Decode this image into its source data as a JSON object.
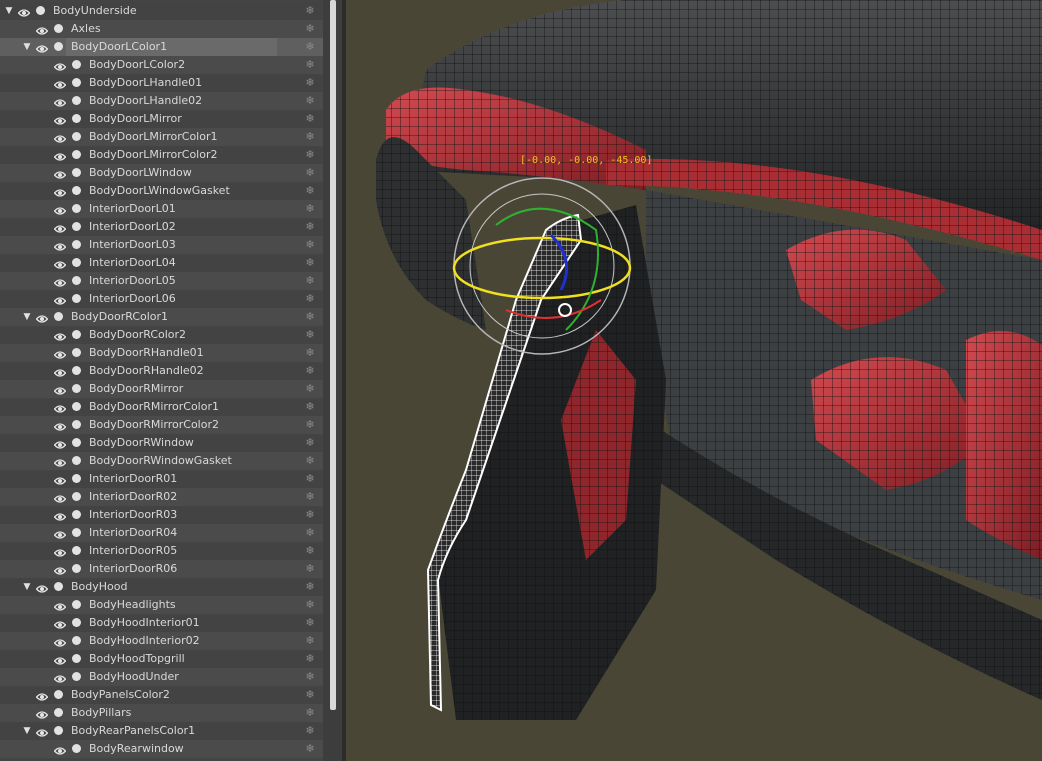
{
  "explorer": {
    "rows": [
      {
        "label": "BodyUnderside",
        "depth": 0,
        "expander": true,
        "selected": false
      },
      {
        "label": "Axles",
        "depth": 1,
        "expander": false,
        "selected": false
      },
      {
        "label": "BodyDoorLColor1",
        "depth": 1,
        "expander": true,
        "selected": true
      },
      {
        "label": "BodyDoorLColor2",
        "depth": 2,
        "expander": false,
        "selected": false
      },
      {
        "label": "BodyDoorLHandle01",
        "depth": 2,
        "expander": false,
        "selected": false
      },
      {
        "label": "BodyDoorLHandle02",
        "depth": 2,
        "expander": false,
        "selected": false
      },
      {
        "label": "BodyDoorLMirror",
        "depth": 2,
        "expander": false,
        "selected": false
      },
      {
        "label": "BodyDoorLMirrorColor1",
        "depth": 2,
        "expander": false,
        "selected": false
      },
      {
        "label": "BodyDoorLMirrorColor2",
        "depth": 2,
        "expander": false,
        "selected": false
      },
      {
        "label": "BodyDoorLWindow",
        "depth": 2,
        "expander": false,
        "selected": false
      },
      {
        "label": "BodyDoorLWindowGasket",
        "depth": 2,
        "expander": false,
        "selected": false
      },
      {
        "label": "InteriorDoorL01",
        "depth": 2,
        "expander": false,
        "selected": false
      },
      {
        "label": "InteriorDoorL02",
        "depth": 2,
        "expander": false,
        "selected": false
      },
      {
        "label": "InteriorDoorL03",
        "depth": 2,
        "expander": false,
        "selected": false
      },
      {
        "label": "InteriorDoorL04",
        "depth": 2,
        "expander": false,
        "selected": false
      },
      {
        "label": "InteriorDoorL05",
        "depth": 2,
        "expander": false,
        "selected": false
      },
      {
        "label": "InteriorDoorL06",
        "depth": 2,
        "expander": false,
        "selected": false
      },
      {
        "label": "BodyDoorRColor1",
        "depth": 1,
        "expander": true,
        "selected": false
      },
      {
        "label": "BodyDoorRColor2",
        "depth": 2,
        "expander": false,
        "selected": false
      },
      {
        "label": "BodyDoorRHandle01",
        "depth": 2,
        "expander": false,
        "selected": false
      },
      {
        "label": "BodyDoorRHandle02",
        "depth": 2,
        "expander": false,
        "selected": false
      },
      {
        "label": "BodyDoorRMirror",
        "depth": 2,
        "expander": false,
        "selected": false
      },
      {
        "label": "BodyDoorRMirrorColor1",
        "depth": 2,
        "expander": false,
        "selected": false
      },
      {
        "label": "BodyDoorRMirrorColor2",
        "depth": 2,
        "expander": false,
        "selected": false
      },
      {
        "label": "BodyDoorRWindow",
        "depth": 2,
        "expander": false,
        "selected": false
      },
      {
        "label": "BodyDoorRWindowGasket",
        "depth": 2,
        "expander": false,
        "selected": false
      },
      {
        "label": "InteriorDoorR01",
        "depth": 2,
        "expander": false,
        "selected": false
      },
      {
        "label": "InteriorDoorR02",
        "depth": 2,
        "expander": false,
        "selected": false
      },
      {
        "label": "InteriorDoorR03",
        "depth": 2,
        "expander": false,
        "selected": false
      },
      {
        "label": "InteriorDoorR04",
        "depth": 2,
        "expander": false,
        "selected": false
      },
      {
        "label": "InteriorDoorR05",
        "depth": 2,
        "expander": false,
        "selected": false
      },
      {
        "label": "InteriorDoorR06",
        "depth": 2,
        "expander": false,
        "selected": false
      },
      {
        "label": "BodyHood",
        "depth": 1,
        "expander": true,
        "selected": false
      },
      {
        "label": "BodyHeadlights",
        "depth": 2,
        "expander": false,
        "selected": false
      },
      {
        "label": "BodyHoodInterior01",
        "depth": 2,
        "expander": false,
        "selected": false
      },
      {
        "label": "BodyHoodInterior02",
        "depth": 2,
        "expander": false,
        "selected": false
      },
      {
        "label": "BodyHoodTopgrill",
        "depth": 2,
        "expander": false,
        "selected": false
      },
      {
        "label": "BodyHoodUnder",
        "depth": 2,
        "expander": false,
        "selected": false
      },
      {
        "label": "BodyPanelsColor2",
        "depth": 1,
        "expander": false,
        "selected": false
      },
      {
        "label": "BodyPillars",
        "depth": 1,
        "expander": false,
        "selected": false
      },
      {
        "label": "BodyRearPanelsColor1",
        "depth": 1,
        "expander": true,
        "selected": false
      },
      {
        "label": "BodyRearwindow",
        "depth": 2,
        "expander": false,
        "selected": false
      }
    ],
    "icons": {
      "visibility": "eye-icon",
      "render": "dot-icon",
      "freeze": "snowflake-icon",
      "expand": "triangle-down-icon"
    },
    "colors": {
      "panel": "#444444",
      "row_alt": "#4b4b4b",
      "selected": "#6a6a6a",
      "text": "#d9d9d9"
    }
  },
  "viewport": {
    "gizmo_readout": "[-0.00, -0.00, -45.00]",
    "colors": {
      "background": "#4a4636",
      "body_red": "#b8383e",
      "wire": "#111111",
      "door_wire": "#ffffff",
      "gizmo_x": "#e03030",
      "gizmo_y": "#30b030",
      "gizmo_z": "#2030d0",
      "gizmo_view": "#f0e020",
      "readout": "#f0c020"
    }
  }
}
